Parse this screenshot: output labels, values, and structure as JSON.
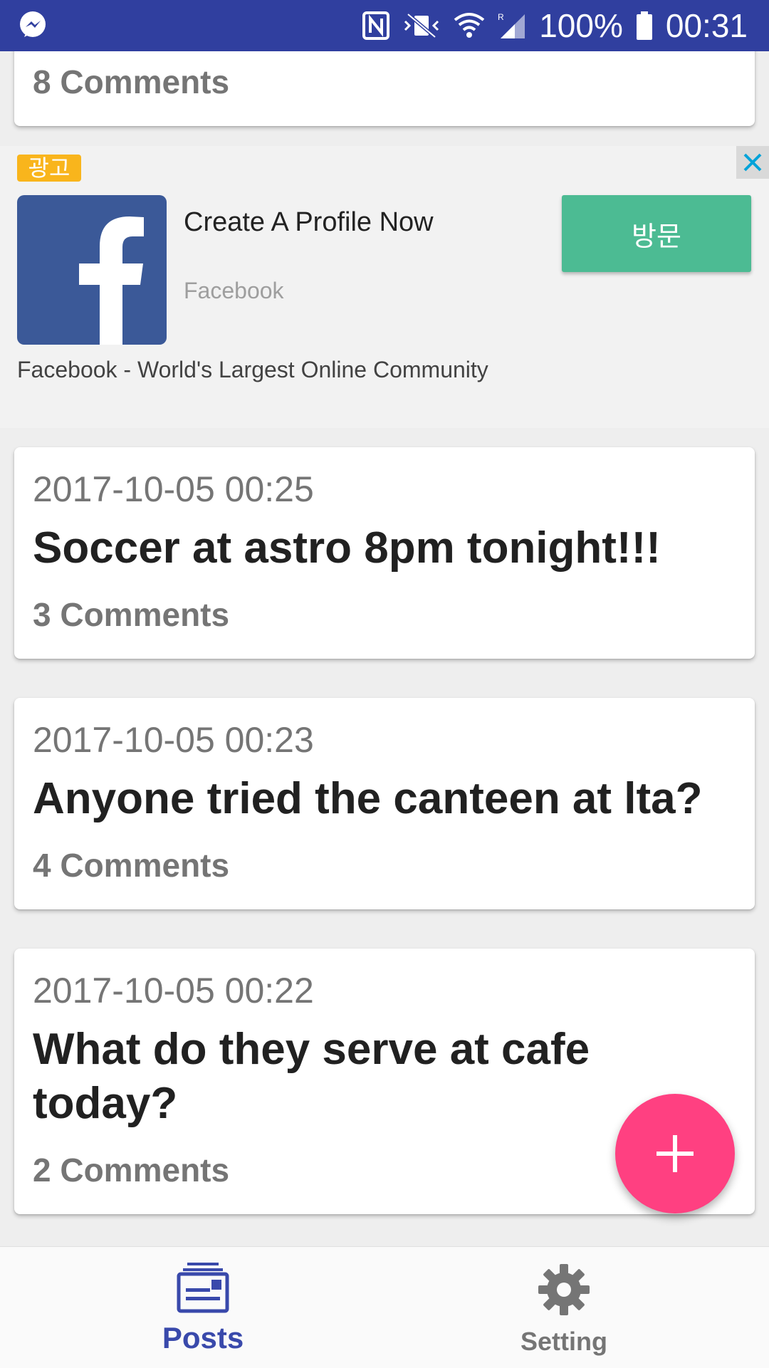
{
  "status_bar": {
    "app_icon": "messenger-icon",
    "battery_level": "100%",
    "time": "00:31",
    "icons": [
      "nfc-icon",
      "vibrate-icon",
      "wifi-icon",
      "signal-icon",
      "battery-icon"
    ]
  },
  "posts": [
    {
      "date": "",
      "title": "",
      "comments": "8 Comments"
    },
    {
      "date": "2017-10-05 00:25",
      "title": "Soccer at astro 8pm tonight!!!",
      "comments": "3 Comments"
    },
    {
      "date": "2017-10-05 00:23",
      "title": "Anyone tried the canteen at lta?",
      "comments": "4 Comments"
    },
    {
      "date": "2017-10-05 00:22",
      "title": "What do they serve at cafe today?",
      "comments": "2 Comments"
    }
  ],
  "ad": {
    "badge": "광고",
    "headline": "Create A Profile Now",
    "advertiser": "Facebook",
    "cta": "방문",
    "body": "Facebook - World's Largest Online Community",
    "logo": "facebook-logo",
    "close_icon": "close-icon"
  },
  "fab": {
    "icon": "plus-icon"
  },
  "bottom_nav": {
    "items": [
      {
        "label": "Posts",
        "icon": "posts-icon",
        "active": true
      },
      {
        "label": "Setting",
        "icon": "gear-icon",
        "active": false
      }
    ]
  },
  "colors": {
    "primary": "#303f9f",
    "accent": "#ff4081",
    "ad_cta": "#4cbb93",
    "active_nav": "#3949ab",
    "inactive_nav": "#757575"
  }
}
